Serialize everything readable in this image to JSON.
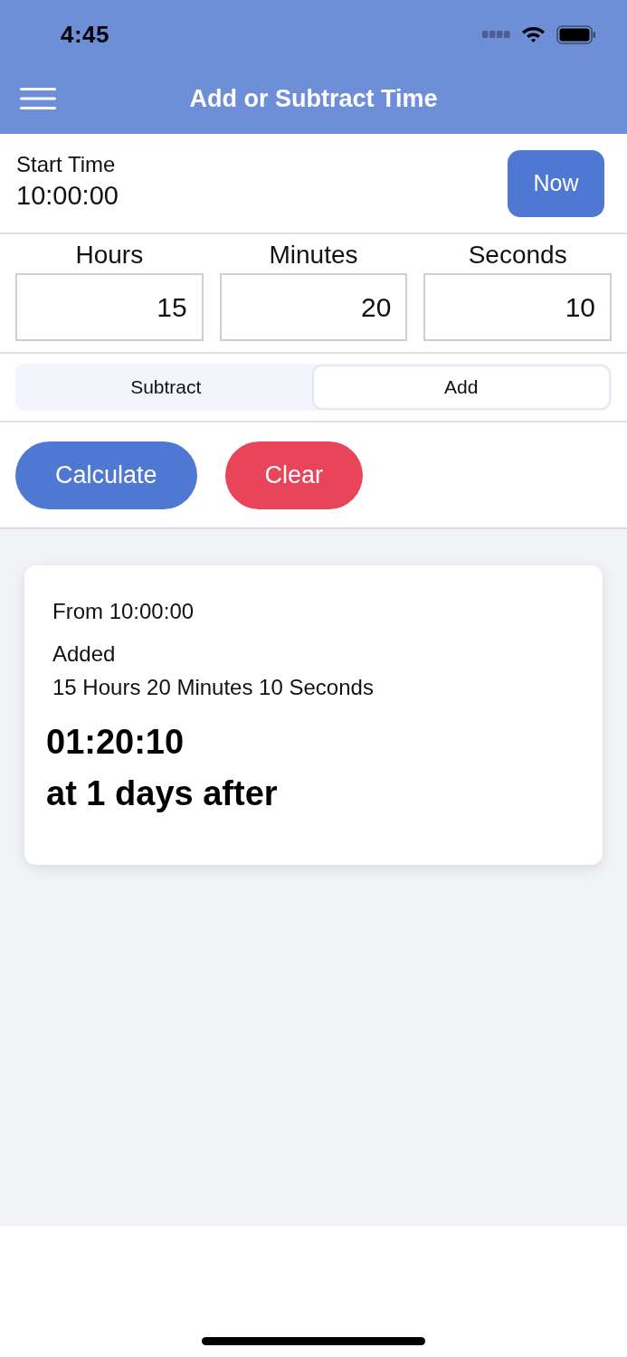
{
  "status_bar": {
    "time": "4:45"
  },
  "nav_bar": {
    "title": "Add or Subtract Time"
  },
  "start_time": {
    "label": "Start Time",
    "value": "10:00:00",
    "button": "Now"
  },
  "duration_fields": [
    {
      "label": "Hours",
      "value": "15"
    },
    {
      "label": "Minutes",
      "value": "20"
    },
    {
      "label": "Seconds",
      "value": "10"
    }
  ],
  "mode_tabs": [
    {
      "label": "Subtract",
      "selected": false
    },
    {
      "label": "Add",
      "selected": true
    }
  ],
  "actions": [
    {
      "label": "Calculate",
      "kind": "primary"
    },
    {
      "label": "Clear",
      "kind": "danger"
    }
  ],
  "result": {
    "from": "From 10:00:00",
    "operation": "Added",
    "amount": "15 Hours 20 Minutes 10 Seconds",
    "time": "01:20:10",
    "day_offset": "at 1 days after"
  }
}
